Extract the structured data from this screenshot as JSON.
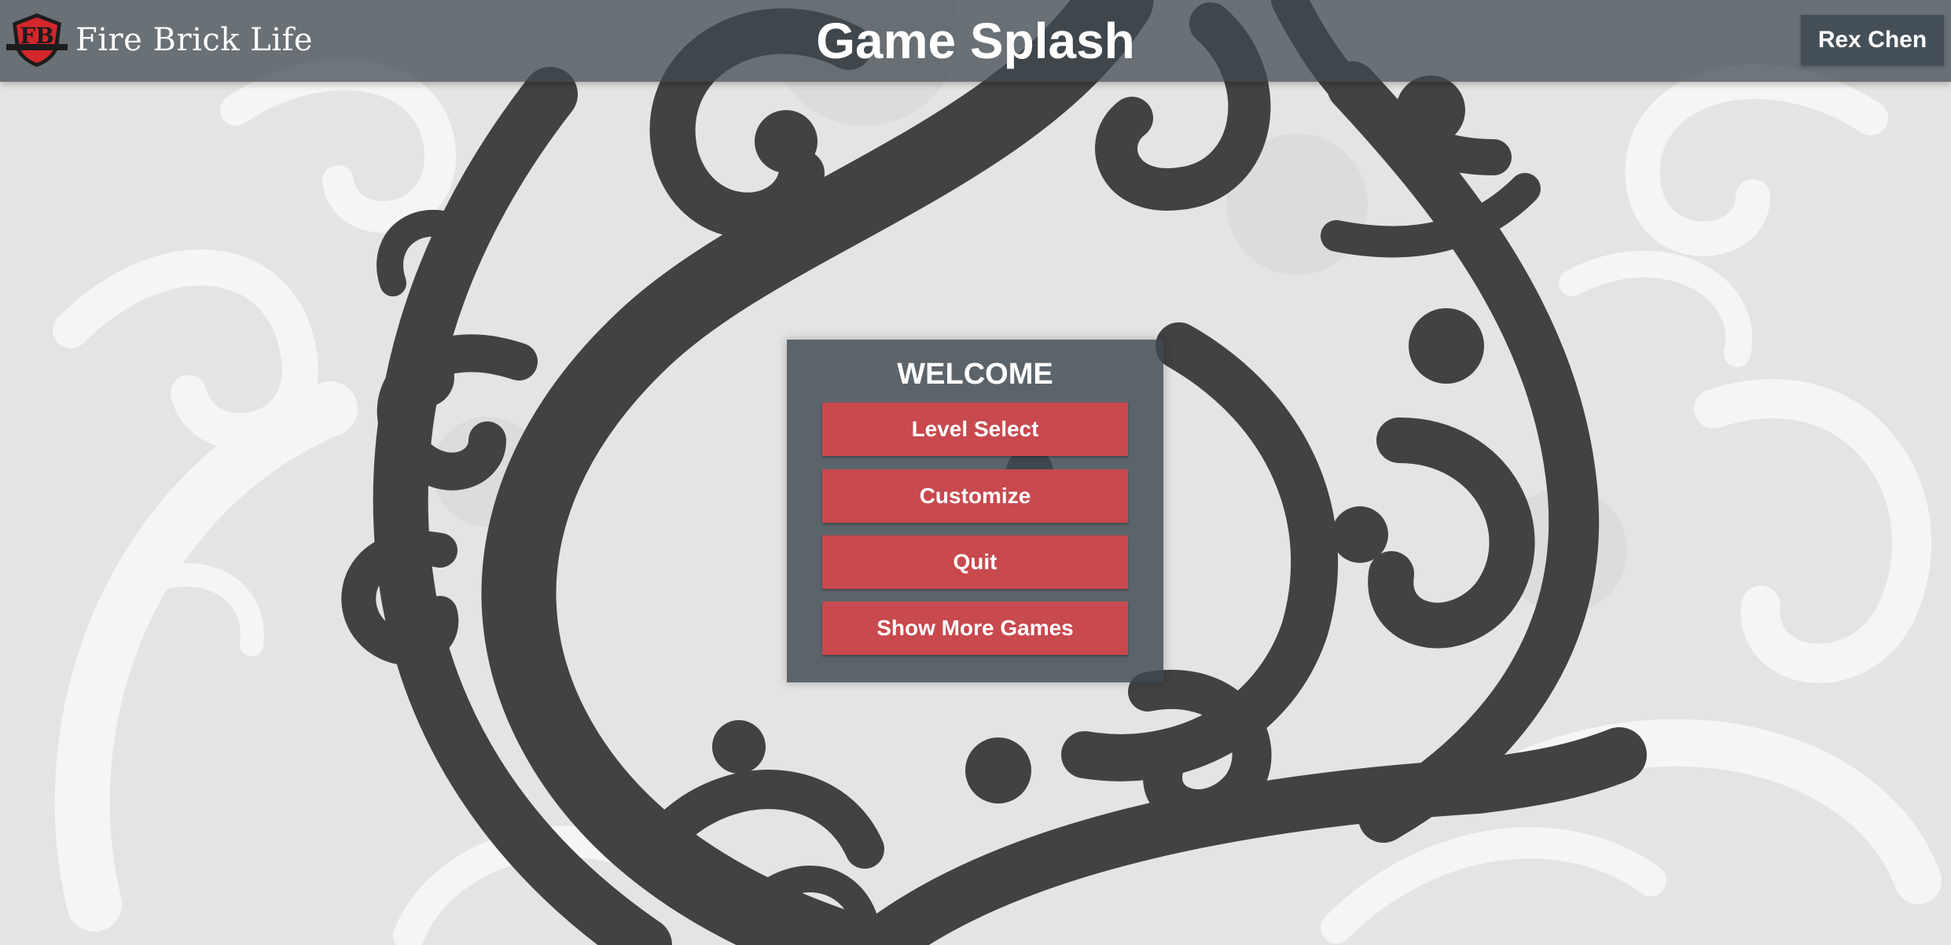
{
  "header": {
    "brand_name": "Fire Brick Life",
    "brand_logo_letters": "FB",
    "page_title": "Game Splash",
    "user_name": "Rex Chen"
  },
  "menu": {
    "title": "WELCOME",
    "items": [
      {
        "label": "Level Select"
      },
      {
        "label": "Customize"
      },
      {
        "label": "Quit"
      },
      {
        "label": "Show More Games"
      }
    ]
  },
  "icons": {
    "logo": "fire-brick-shield-logo",
    "background": "swirling-cloud-art"
  },
  "colors": {
    "topbar": "#3e4850",
    "panel": "#3e4850",
    "button": "#c8494e",
    "user_button": "#454f57",
    "background": "#e6e6e6",
    "swirl_dark": "#424242",
    "swirl_light": "#f7f7f7"
  }
}
